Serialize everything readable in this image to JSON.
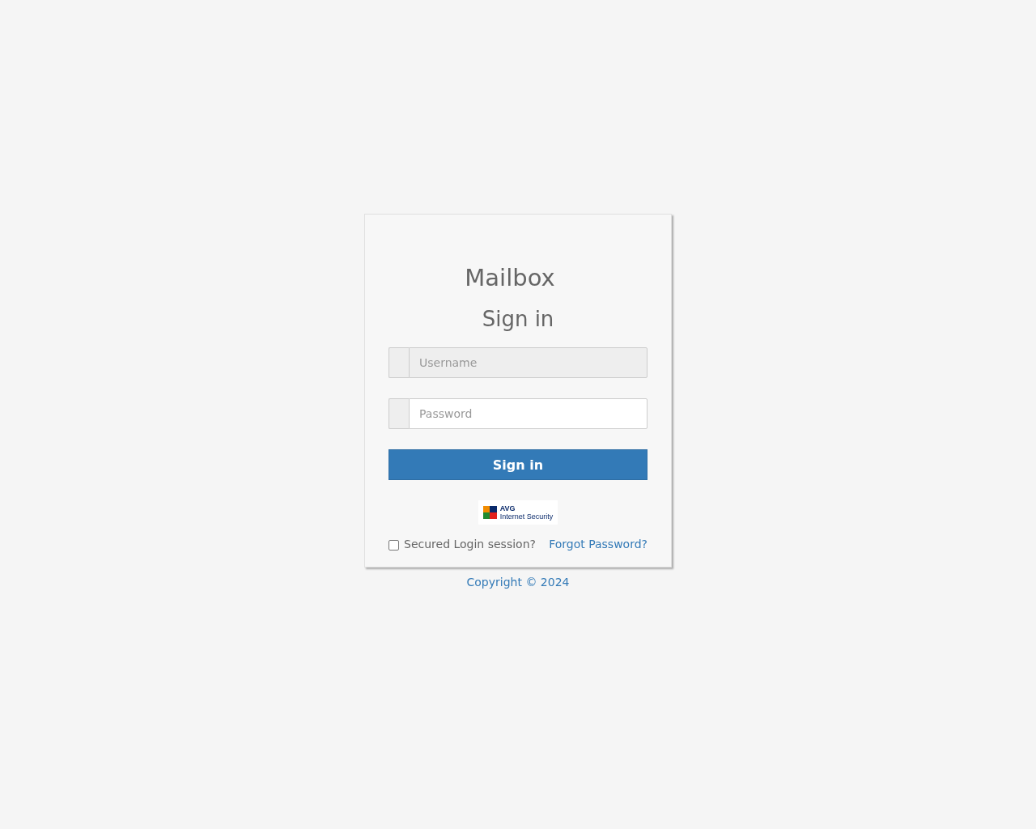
{
  "title": "Mailbox",
  "heading": "Sign in",
  "fields": [
    {
      "placeholder": "Username",
      "disabled": true
    },
    {
      "placeholder": "Password",
      "disabled": false
    }
  ],
  "submit": "Sign in",
  "badge": {
    "name": "AVG",
    "caption": "Internet Security"
  },
  "secure_session": {
    "label": "Secured Login session?",
    "checked": false
  },
  "forgot_link": "Forgot Password?",
  "footer": "Copyright © 2024"
}
